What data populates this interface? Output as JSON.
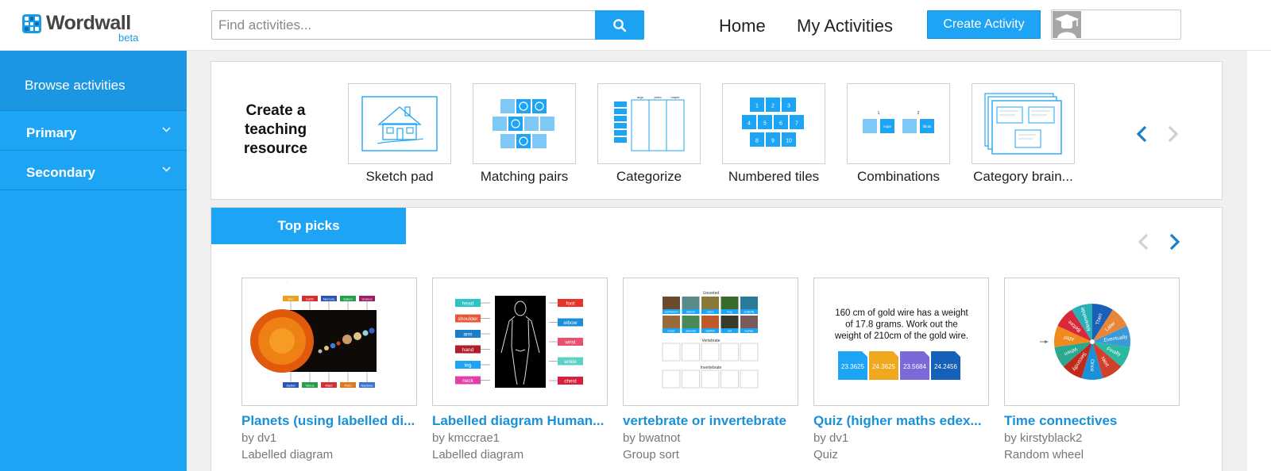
{
  "header": {
    "logo_text": "Wordwall",
    "logo_beta": "beta",
    "search_placeholder": "Find activities...",
    "nav": [
      "Home",
      "My Activities"
    ],
    "create_button": "Create Activity"
  },
  "sidebar": {
    "browse": "Browse activities",
    "items": [
      {
        "label": "Primary"
      },
      {
        "label": "Secondary"
      }
    ]
  },
  "create_panel": {
    "title": "Create a teaching resource",
    "templates": [
      {
        "label": "Sketch pad"
      },
      {
        "label": "Matching pairs"
      },
      {
        "label": "Categorize"
      },
      {
        "label": "Numbered tiles"
      },
      {
        "label": "Combinations"
      },
      {
        "label": "Category brain..."
      }
    ],
    "categorize_headers": [
      "argo",
      "petra",
      "maple"
    ],
    "numbered_tiles": [
      "1",
      "2",
      "3",
      "4",
      "5",
      "6",
      "7",
      "8",
      "9",
      "10"
    ],
    "combination_labels": [
      "1",
      "2",
      "nope",
      "librati"
    ]
  },
  "top_picks": {
    "tab": "Top picks",
    "cards": [
      {
        "title": "Planets (using labelled di...",
        "author": "by dv1",
        "type": "Labelled diagram"
      },
      {
        "title": "Labelled diagram Human...",
        "author": "by kmccrae1",
        "type": "Labelled diagram"
      },
      {
        "title": "vertebrate or invertebrate",
        "author": "by bwatnot",
        "type": "Group sort"
      },
      {
        "title": "Quiz (higher maths edex...",
        "author": "by dv1",
        "type": "Quiz"
      },
      {
        "title": "Time connectives",
        "author": "by kirstyblack2",
        "type": "Random wheel"
      }
    ],
    "planet_labels_top": [
      "Sun",
      "Earth",
      "Mercury",
      "Saturn",
      "Uranus"
    ],
    "planet_labels_bottom": [
      "Jupiter",
      "Venus",
      "Mars",
      "Pluto",
      "Neptune"
    ],
    "body_labels_left": [
      "head",
      "shoulder",
      "arm",
      "hand",
      "leg",
      "neck"
    ],
    "body_labels_right": [
      "foot",
      "elbow",
      "wrist",
      "ankle",
      "chest"
    ],
    "vertebrate_headers": [
      "Unsorted",
      "Vertebrate",
      "Invertebrate"
    ],
    "vertebrate_animals": [
      "earthworm",
      "salmon",
      "cobra",
      "frog",
      "butterfly",
      "horse",
      "amoeba",
      "starfish",
      "ant",
      "human"
    ],
    "quiz_question": "160 cm of gold wire has a weight of 17.8 grams. Work out the weight of 210cm of the gold wire.",
    "quiz_answers": [
      "23.3625",
      "24.3625",
      "23.5684",
      "24.2456"
    ],
    "wheel_words": [
      "Then",
      "Later",
      "Eventually",
      "Finally",
      "Next",
      "Once",
      "Secondly",
      "When",
      "After",
      "Before",
      "Meanwhile"
    ]
  },
  "colors": {
    "accent": "#1ea4f5",
    "link": "#1a90d9"
  }
}
